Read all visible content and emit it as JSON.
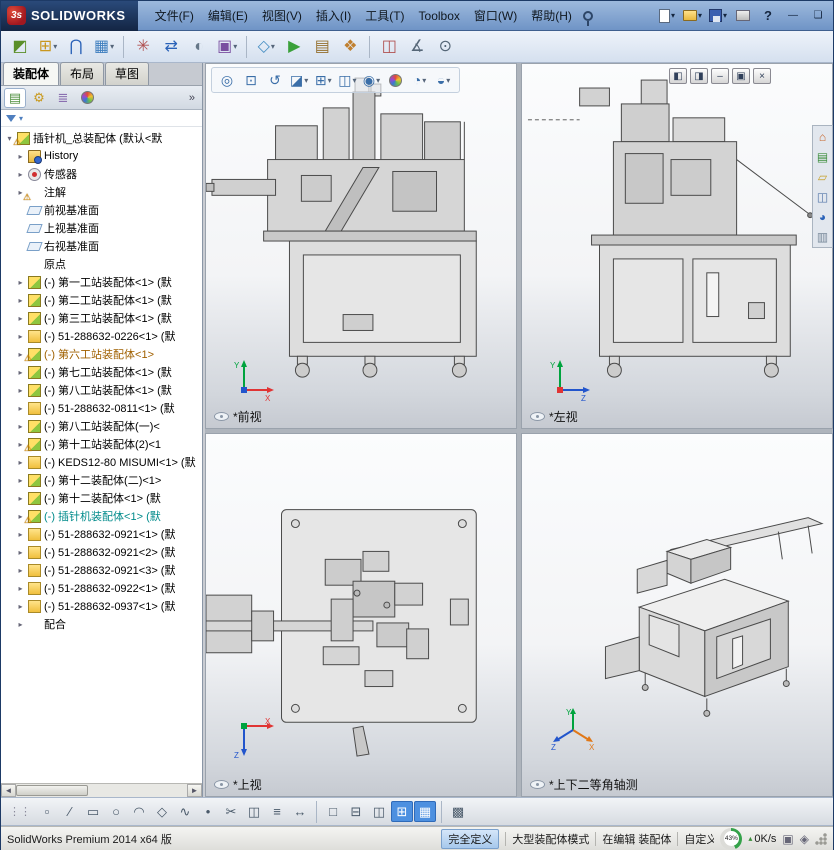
{
  "titlebar": {
    "logo_mark": "3s",
    "logo_text": "SOLIDWORKS",
    "menus": [
      "文件(F)",
      "编辑(E)",
      "视图(V)",
      "插入(I)",
      "工具(T)",
      "Toolbox",
      "窗口(W)",
      "帮助(H)"
    ],
    "buttons": [
      {
        "name": "new-document-button",
        "icon": "page",
        "caret": true
      },
      {
        "name": "open-document-button",
        "icon": "folder",
        "caret": true
      },
      {
        "name": "save-button",
        "icon": "floppy",
        "caret": true
      },
      {
        "name": "print-button",
        "icon": "print"
      },
      {
        "name": "help-button",
        "icon": "help"
      },
      {
        "name": "minimize-window-button",
        "icon": "min"
      },
      {
        "name": "maximize-window-button",
        "icon": "max"
      }
    ]
  },
  "toolbar": {
    "buttons": [
      {
        "name": "edit-component-button",
        "glyph": "◩",
        "color": "#5a8f29"
      },
      {
        "name": "insert-components-button",
        "glyph": "⊞",
        "color": "#c9971f",
        "caret": true
      },
      {
        "name": "mate-button",
        "glyph": "⋂",
        "color": "#2a62b8"
      },
      {
        "name": "linear-component-pattern-button",
        "glyph": "▦",
        "color": "#3f7fbf",
        "caret": true
      },
      {
        "name": "smart-fasteners-button",
        "glyph": "✳",
        "color": "#b05050",
        "sep_before": true
      },
      {
        "name": "move-component-button",
        "glyph": "⇄",
        "color": "#2a62b8"
      },
      {
        "name": "show-hidden-components-button",
        "glyph": "◐",
        "color": "#667788"
      },
      {
        "name": "assembly-features-button",
        "glyph": "▣",
        "color": "#7a4fa0",
        "caret": true
      },
      {
        "name": "reference-geometry-button",
        "glyph": "◇",
        "color": "#4a90c4",
        "caret": true,
        "sep_before": true
      },
      {
        "name": "new-motion-study-button",
        "glyph": "▶",
        "color": "#3aa03a"
      },
      {
        "name": "bill-of-materials-button",
        "glyph": "▤",
        "color": "#946f2e"
      },
      {
        "name": "exploded-view-button",
        "glyph": "❖",
        "color": "#c08030"
      },
      {
        "name": "interference-detection-button",
        "glyph": "◫",
        "color": "#b05050",
        "sep_before": true
      },
      {
        "name": "measure-button",
        "glyph": "∡",
        "color": "#556677"
      },
      {
        "name": "mass-properties-button",
        "glyph": "⊙",
        "color": "#556677"
      }
    ]
  },
  "command_tabs": {
    "tabs": [
      {
        "name": "tab-assembly",
        "label": "装配体",
        "active": true
      },
      {
        "name": "tab-layout",
        "label": "布局",
        "active": false
      },
      {
        "name": "tab-sketch",
        "label": "草图",
        "active": false
      }
    ]
  },
  "feature_panel": {
    "expand_label": "»",
    "tabs": [
      {
        "name": "featuremanager-tab",
        "glyph": "▤",
        "color": "#4f8f3f",
        "active": true
      },
      {
        "name": "propertymanager-tab",
        "glyph": "⚙",
        "color": "#c99a1f"
      },
      {
        "name": "configurationmanager-tab",
        "glyph": "≣",
        "color": "#8a6fb0"
      },
      {
        "name": "dimxpertmanager-tab",
        "ball": true
      }
    ],
    "tree": [
      {
        "icon": "assembly",
        "warn": true,
        "caret": "▾",
        "label": "插针机_总装配体 (默认<默",
        "indent": 0
      },
      {
        "icon": "history",
        "caret": "▸",
        "label": "History",
        "indent": 1
      },
      {
        "icon": "sensor",
        "caret": "▸",
        "label": "传感器",
        "indent": 1
      },
      {
        "icon": "annot",
        "warn": true,
        "caret": "▸",
        "label": "注解",
        "indent": 1
      },
      {
        "icon": "plane",
        "caret": "",
        "label": "前视基准面",
        "indent": 1
      },
      {
        "icon": "plane",
        "caret": "",
        "label": "上视基准面",
        "indent": 1
      },
      {
        "icon": "plane",
        "caret": "",
        "label": "右视基准面",
        "indent": 1
      },
      {
        "icon": "origin",
        "caret": "",
        "label": "原点",
        "indent": 1
      },
      {
        "icon": "assembly",
        "caret": "▸",
        "label": "(-) 第一工站装配体<1> (默",
        "indent": 1
      },
      {
        "icon": "assembly",
        "caret": "▸",
        "label": "(-) 第二工站装配体<1> (默",
        "indent": 1
      },
      {
        "icon": "assembly",
        "caret": "▸",
        "label": "(-) 第三工站装配体<1> (默",
        "indent": 1
      },
      {
        "icon": "part",
        "caret": "▸",
        "label": "(-) 51-288632-0226<1> (默",
        "indent": 1
      },
      {
        "icon": "assembly",
        "warn": true,
        "caret": "▸",
        "label": "(-) 第六工站装配体<1>",
        "color": "#a06000",
        "indent": 1
      },
      {
        "icon": "assembly",
        "caret": "▸",
        "label": "(-) 第七工站装配体<1> (默",
        "indent": 1
      },
      {
        "icon": "assembly",
        "caret": "▸",
        "label": "(-) 第八工站装配体<1> (默",
        "indent": 1
      },
      {
        "icon": "part",
        "caret": "▸",
        "label": "(-) 51-288632-0811<1> (默",
        "indent": 1
      },
      {
        "icon": "assembly",
        "caret": "▸",
        "label": "(-) 第八工站装配体(一)<",
        "indent": 1
      },
      {
        "icon": "assembly",
        "warn": true,
        "caret": "▸",
        "label": "(-) 第十工站装配体(2)<1",
        "indent": 1
      },
      {
        "icon": "part",
        "caret": "▸",
        "label": "(-) KEDS12-80 MISUMI<1> (默",
        "indent": 1
      },
      {
        "icon": "assembly",
        "caret": "▸",
        "label": "(-) 第十二装配体(二)<1>",
        "indent": 1
      },
      {
        "icon": "assembly",
        "caret": "▸",
        "label": "(-) 第十二装配体<1> (默",
        "indent": 1
      },
      {
        "icon": "assembly",
        "warn": true,
        "caret": "▸",
        "label": "(-) 插针机装配体<1> (默",
        "color": "#008b8b",
        "indent": 1
      },
      {
        "icon": "part",
        "caret": "▸",
        "label": "(-) 51-288632-0921<1> (默",
        "indent": 1
      },
      {
        "icon": "part",
        "caret": "▸",
        "label": "(-) 51-288632-0921<2> (默",
        "indent": 1
      },
      {
        "icon": "part",
        "caret": "▸",
        "label": "(-) 51-288632-0921<3> (默",
        "indent": 1
      },
      {
        "icon": "part",
        "caret": "▸",
        "label": "(-) 51-288632-0922<1> (默",
        "indent": 1
      },
      {
        "icon": "part",
        "caret": "▸",
        "label": "(-) 51-288632-0937<1> (默",
        "indent": 1
      },
      {
        "icon": "mates",
        "caret": "▸",
        "label": "配合",
        "indent": 1
      }
    ]
  },
  "viewport": {
    "window_buttons": [
      {
        "name": "tile-horizontally-button",
        "glyph": "◧"
      },
      {
        "name": "tile-vertically-button",
        "glyph": "◨"
      },
      {
        "name": "minimize-document-button",
        "glyph": "–"
      },
      {
        "name": "restore-document-button",
        "glyph": "▣"
      },
      {
        "name": "close-document-button",
        "glyph": "×"
      }
    ],
    "headsup": [
      {
        "name": "zoom-fit-button",
        "glyph": "◎"
      },
      {
        "name": "zoom-area-button",
        "glyph": "⊡"
      },
      {
        "name": "previous-view-button",
        "glyph": "↺"
      },
      {
        "name": "section-view-button",
        "glyph": "◪",
        "caret": true
      },
      {
        "name": "view-orientation-button",
        "glyph": "⊞",
        "caret": true
      },
      {
        "name": "display-style-button",
        "glyph": "◫",
        "caret": true
      },
      {
        "name": "hide-show-items-button",
        "glyph": "◉",
        "caret": true
      },
      {
        "name": "edit-appearance-button",
        "ball": true
      },
      {
        "name": "apply-scene-button",
        "glyph": "◔",
        "caret": true
      },
      {
        "name": "view-settings-button",
        "glyph": "◒",
        "caret": true
      }
    ],
    "panes": [
      {
        "label": "*前视",
        "axes": [
          "Y",
          "X"
        ]
      },
      {
        "label": "*左视",
        "axes": [
          "Y",
          "Z"
        ]
      },
      {
        "label": "*上视",
        "axes": [
          "X",
          "Z"
        ]
      },
      {
        "label": "*上下二等角轴测",
        "axes": [
          "Y",
          "X",
          "Z"
        ]
      }
    ]
  },
  "taskpane": {
    "tabs": [
      {
        "name": "solidworks-resources-tab",
        "glyph": "⌂",
        "color": "#c7642a"
      },
      {
        "name": "design-library-tab",
        "glyph": "▤",
        "color": "#3f8f3f"
      },
      {
        "name": "file-explorer-tab",
        "glyph": "▱",
        "color": "#c7a12a"
      },
      {
        "name": "view-palette-tab",
        "glyph": "◫",
        "color": "#5577aa"
      },
      {
        "name": "appearances-tab",
        "glyph": "◕",
        "color": "#2a62b8"
      },
      {
        "name": "custom-properties-tab",
        "glyph": "▥",
        "color": "#778899"
      }
    ]
  },
  "bottombar": {
    "buttons": [
      {
        "name": "select-tool-button",
        "glyph": "▫"
      },
      {
        "name": "line-tool-button",
        "glyph": "∕"
      },
      {
        "name": "rectangle-tool-button",
        "glyph": "▭"
      },
      {
        "name": "circle-tool-button",
        "glyph": "○"
      },
      {
        "name": "arc-tool-button",
        "glyph": "◠"
      },
      {
        "name": "polygon-tool-button",
        "glyph": "◇"
      },
      {
        "name": "spline-tool-button",
        "glyph": "∿"
      },
      {
        "name": "point-tool-button",
        "glyph": "•"
      },
      {
        "name": "trim-tool-button",
        "glyph": "✂"
      },
      {
        "name": "mirror-tool-button",
        "glyph": "◫"
      },
      {
        "name": "offset-tool-button",
        "glyph": "≡"
      },
      {
        "name": "smart-dimension-button",
        "glyph": "↔"
      },
      {
        "name": "viewport-single-button",
        "glyph": "□",
        "sep_before": true
      },
      {
        "name": "viewport-two-horizontal-button",
        "glyph": "⊟"
      },
      {
        "name": "viewport-two-vertical-button",
        "glyph": "◫"
      },
      {
        "name": "viewport-four-button",
        "glyph": "⊞",
        "active": true
      },
      {
        "name": "link-views-button",
        "glyph": "▦",
        "active": true
      },
      {
        "name": "grid-settings-button",
        "glyph": "▩",
        "sep_before": true
      }
    ]
  },
  "statusbar": {
    "product": "SolidWorks Premium 2014 x64 版",
    "fields": [
      {
        "name": "fully-defined-status",
        "label": "完全定义",
        "highlight": true
      },
      {
        "name": "large-assembly-mode-status",
        "label": "大型装配体模式"
      },
      {
        "name": "editing-status",
        "label": "在编辑 装配体"
      },
      {
        "name": "custom-status",
        "label": "自定义",
        "clip": true
      }
    ],
    "gauge_value": "43%",
    "network": "0K/s"
  }
}
